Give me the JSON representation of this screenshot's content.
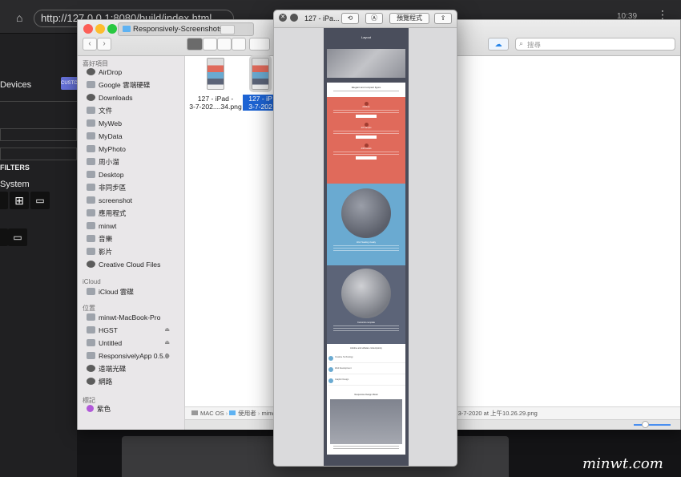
{
  "browser": {
    "url": "http://127.0.0.1:8080/build/index.html",
    "time": "10:39",
    "sidebar": {
      "devices_label": "Devices",
      "custom_label": "CUSTO",
      "filters_label": "FILTERS",
      "system_label": "System"
    }
  },
  "finder": {
    "title": "Responsively-Screenshots",
    "search_placeholder": "搜尋",
    "sidebar": {
      "favorites_header": "喜好項目",
      "favorites": [
        "AirDrop",
        "Google 雲端硬碟",
        "Downloads",
        "文件",
        "MyWeb",
        "MyData",
        "MyPhoto",
        "周小溜",
        "Desktop",
        "非同步區",
        "screenshot",
        "應用程式",
        "minwt",
        "音樂",
        "影片",
        "Creative Cloud Files"
      ],
      "icloud_header": "iCloud",
      "icloud": [
        "iCloud 雲碟"
      ],
      "locations_header": "位置",
      "locations": [
        "minwt-MacBook-Pro",
        "HGST",
        "Untitled",
        "ResponsivelyApp 0.5.0",
        "遠端光碟",
        "網路"
      ],
      "tags_header": "標記",
      "tags": [
        "紫色"
      ]
    },
    "files": [
      {
        "line1": "127 - iPad -",
        "line2": "3-7-202....34.png",
        "selected": false
      },
      {
        "line1": "127 - iP",
        "line2": "3-7-202",
        "selected": true
      }
    ],
    "path_bar": [
      "MAC OS",
      "使用者",
      "minwt"
    ],
    "path_tail": "- 3-7-2020 at 上午10.26.29.png"
  },
  "quicklook": {
    "title": "127 - iPa...",
    "open_with_label": "預覽程式",
    "doc": {
      "header_title": "Layout",
      "sec1_title": "Elegant and compact figure",
      "red_items": [
        "Attribute",
        "Job Sample",
        "JOB Details"
      ],
      "blue_title": "Web Heading Usually",
      "slate_title": "Customize template",
      "white_title": "Lifetime and software contemporary",
      "list_items": [
        "Creative Technology",
        "Web Development",
        "Graphic Design"
      ],
      "footer_title": "Responsive Design Model"
    }
  },
  "watermark": "minwt.com"
}
